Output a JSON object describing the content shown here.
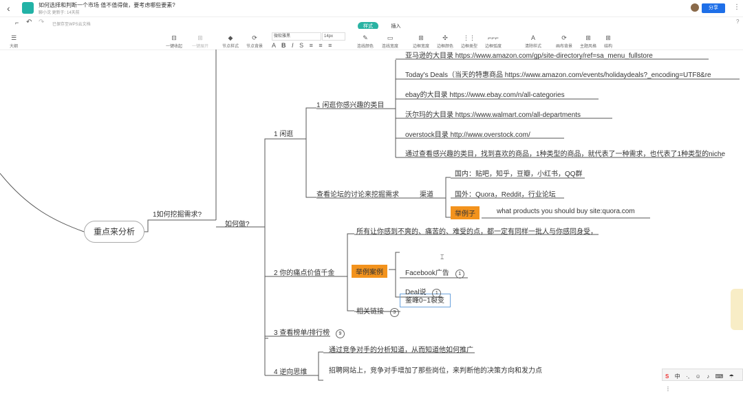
{
  "window": {
    "doc_title": "如何选择和判断一个市场 值不值得做，要考虑哪些要素?",
    "doc_meta": "聊小沈  更新于: 14天前",
    "share_label": "分享",
    "back_icon": "chevron-left-icon"
  },
  "header": {
    "save_status": "已保存至WPS云文档",
    "tabs": [
      "样式",
      "插入"
    ],
    "active_tab": "样式"
  },
  "toolbar": {
    "outline": "大纲",
    "collapse_one": "一键收起",
    "expand_one": "一键展开",
    "node_style": "节点样式",
    "node_bg": "节点背景",
    "font_family": "微软雅黑",
    "font_size": "14px",
    "line_color": "连线颜色",
    "line_width": "连线宽度",
    "border_width": "边框宽度",
    "border_color": "边框颜色",
    "border_type": "边框类型",
    "border_radius": "边框弧度",
    "clear_style": "清除样式",
    "canvas_bg": "画布背景",
    "theme_style": "主题风格",
    "structure": "结构"
  },
  "mindmap": {
    "central": "重点来分析",
    "l1": "1如何挖掘需求?",
    "l2": "如何做?",
    "b1": "1 闲逛",
    "b1_1": "1 闲逛你感兴趣的类目",
    "b1_1_items": [
      "亚马逊的大目录        https://www.amazon.com/gp/site-directory/ref=sa_menu_fullstore",
      "Today's Deals（当天的特惠商品        https://www.amazon.com/events/holidaydeals?_encoding=UTF8&re",
      "ebay的大目录        https://www.ebay.com/n/all-categories",
      "沃尔玛的大目录        https://www.walmart.com/all-departments",
      "overstock目录        http://www.overstock.com/",
      "通过查看感兴趣的类目，找到喜欢的商品，1种类型的商品，就代表了一种需求，也代表了1种类型的niche"
    ],
    "b1_2": "查看论坛的讨论来挖掘需求",
    "b1_2_channel": "渠道",
    "b1_2_cn": "国内：贴吧，知乎，豆瓣，小红书，QQ群",
    "b1_2_foreign": "国外：Quora，Reddit，行业论坛",
    "b1_2_example_tag": "举例子",
    "b1_2_example": "what products you should buy site:quora.com",
    "b2": "2 你的痛点价值千金",
    "b2_pain": "所有让你感到不爽的、痛苦的、难受的点，都一定有同样一批人与你感同身受，",
    "b2_case_tag": "举例案例",
    "b2_case1": "鉴峰0~1裂变",
    "b2_case2": "Facebook广告",
    "b2_case2_badge": "1",
    "b2_case3": "Deal说",
    "b2_case3_badge": "1",
    "b2_links": "相关链接",
    "b2_links_badge": "3",
    "b3": "3 查看榜单/排行榜",
    "b3_badge": "9",
    "b4": "4 逆向思维",
    "b4_1": "通过竞争对手的分析知道，从而知道他如何推广",
    "b4_2": "招聘网站上，竞争对手增加了那些岗位，来判断他的决策方向和发力点"
  },
  "tray": {
    "ime": "中"
  },
  "colors": {
    "accent": "#2ab3a3",
    "share": "#1e6fe8",
    "tag": "#f3931d",
    "line": "#555555"
  }
}
